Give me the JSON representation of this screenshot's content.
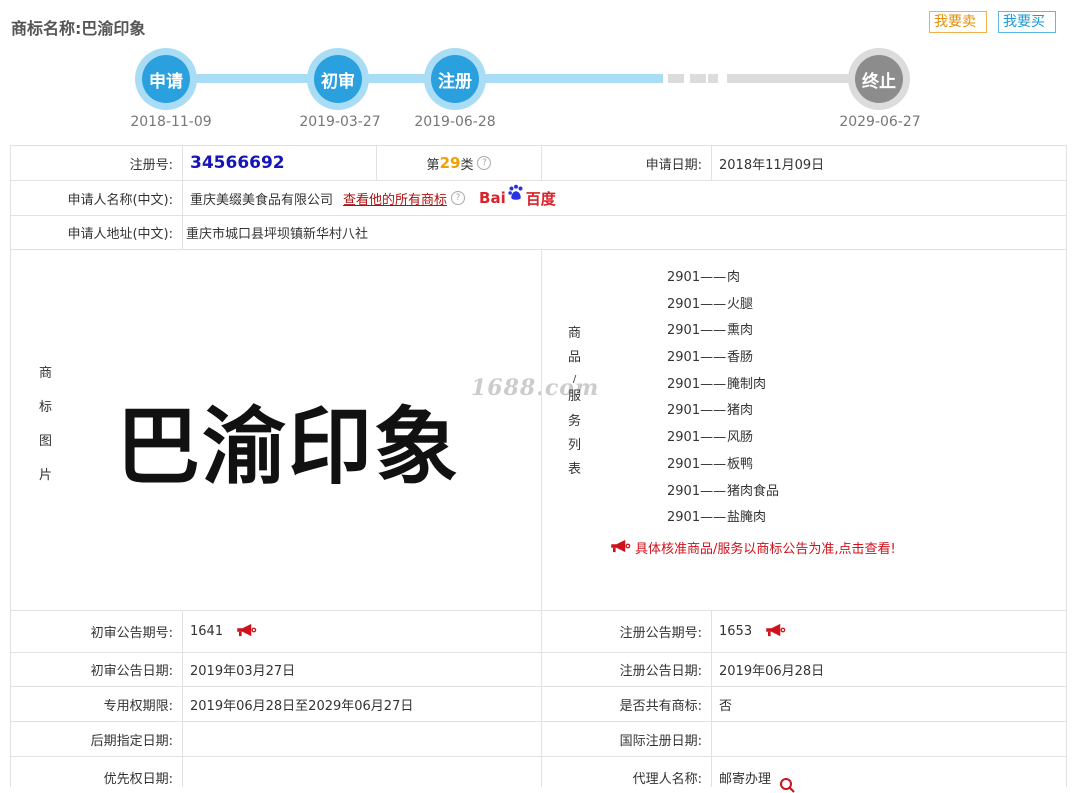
{
  "header": {
    "label": "商标名称:",
    "trademark_name": "巴渝印象",
    "sell_label": "我要卖",
    "buy_label": "我要买"
  },
  "timeline": {
    "steps": [
      {
        "label": "申请",
        "date": "2018-11-09",
        "state": "done"
      },
      {
        "label": "初审",
        "date": "2019-03-27",
        "state": "done"
      },
      {
        "label": "注册",
        "date": "2019-06-28",
        "state": "done"
      },
      {
        "label": "终止",
        "date": "2029-06-27",
        "state": "future"
      }
    ]
  },
  "details": {
    "reg_no_label": "注册号:",
    "reg_no": "34566692",
    "class_prefix": "第",
    "class_num": "29",
    "class_suffix": "类",
    "apply_date_label": "申请日期:",
    "apply_date": "2018年11月09日",
    "applicant_label": "申请人名称(中文):",
    "applicant": "重庆美缀美食品有限公司",
    "view_all_link": "查看他的所有商标",
    "baidu_left": "Bai",
    "baidu_right": "百度",
    "address_label": "申请人地址(中文):",
    "address": "重庆市城口县坪坝镇新华村八社",
    "image_label_chars": [
      "商",
      "标",
      "图",
      "片"
    ],
    "tm_image_text": "巴渝印象",
    "watermark": "1688.com",
    "services_label_chars": [
      "商",
      "品",
      "/",
      "服",
      "务",
      "列",
      "表"
    ],
    "services": [
      {
        "code": "2901——",
        "name": "肉"
      },
      {
        "code": "2901——",
        "name": "火腿"
      },
      {
        "code": "2901——",
        "name": "熏肉"
      },
      {
        "code": "2901——",
        "name": "香肠"
      },
      {
        "code": "2901——",
        "name": "腌制肉"
      },
      {
        "code": "2901——",
        "name": "猪肉"
      },
      {
        "code": "2901——",
        "name": "风肠"
      },
      {
        "code": "2901——",
        "name": "板鸭"
      },
      {
        "code": "2901——",
        "name": "猪肉食品"
      },
      {
        "code": "2901——",
        "name": "盐腌肉"
      }
    ],
    "services_notice": "具体核准商品/服务以商标公告为准,点击查看!",
    "prelim_issue_label": "初审公告期号:",
    "prelim_issue": "1641",
    "reg_issue_label": "注册公告期号:",
    "reg_issue": "1653",
    "prelim_date_label": "初审公告日期:",
    "prelim_date": "2019年03月27日",
    "reg_date_label": "注册公告日期:",
    "reg_date": "2019年06月28日",
    "exclusive_label": "专用权期限:",
    "exclusive": "2019年06月28日至2029年06月27日",
    "shared_label": "是否共有商标:",
    "shared": "否",
    "later_label": "后期指定日期:",
    "later": "",
    "intl_label": "国际注册日期:",
    "intl": "",
    "priority_label": "优先权日期:",
    "priority": "",
    "agent_label": "代理人名称:",
    "agent": "邮寄办理"
  },
  "colors": {
    "step_done": "#2aa0de",
    "step_future": "#8c8c8c",
    "reg_no": "#1515b8",
    "class_num": "#f0a000",
    "link": "#b01010",
    "notice": "#d0101a"
  }
}
